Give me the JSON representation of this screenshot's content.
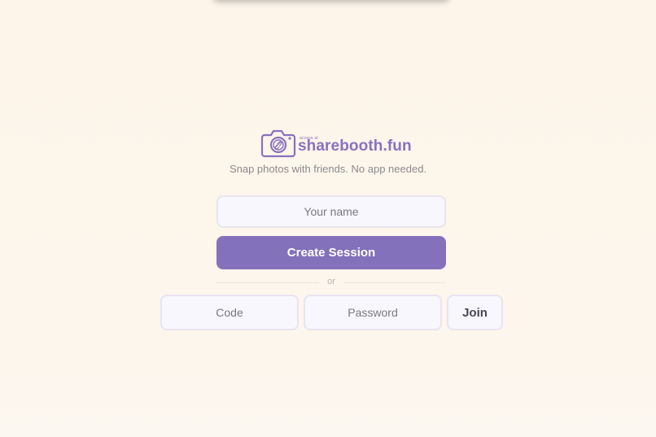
{
  "brand": {
    "tagline_small": "access at",
    "name": "sharebooth.fun",
    "accent_color": "#8471bb"
  },
  "hero": {
    "tagline": "Snap photos with friends. No app needed."
  },
  "create": {
    "name_placeholder": "Your name",
    "button_label": "Create Session"
  },
  "divider": {
    "label": "or"
  },
  "join": {
    "code_placeholder": "Code",
    "password_placeholder": "Password",
    "button_label": "Join"
  }
}
